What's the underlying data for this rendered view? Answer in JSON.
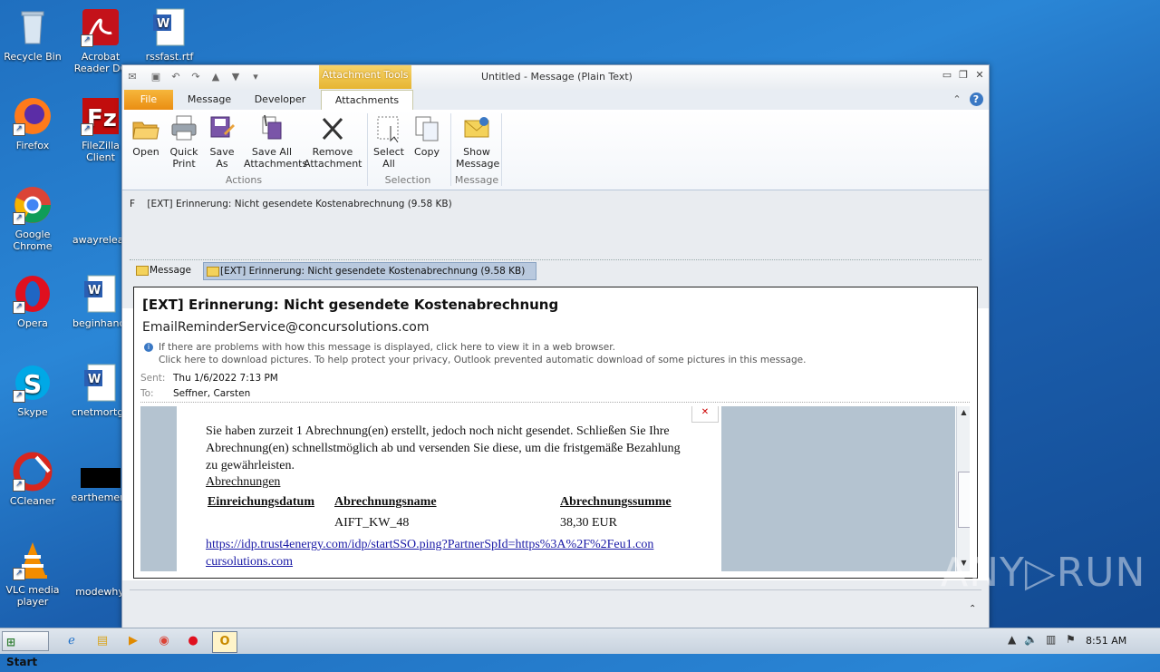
{
  "desktop": {
    "icons": [
      {
        "label": "Recycle Bin",
        "icon": "recycle-bin-icon"
      },
      {
        "label": "Acrobat Reader DC",
        "icon": "acrobat-icon"
      },
      {
        "label": "rssfast.rtf",
        "icon": "word-doc-icon"
      },
      {
        "label": "Firefox",
        "icon": "firefox-icon"
      },
      {
        "label": "FileZilla Client",
        "icon": "filezilla-icon"
      },
      {
        "label": "Google Chrome",
        "icon": "chrome-icon"
      },
      {
        "label": "awayreleas",
        "icon": "blank-file-icon"
      },
      {
        "label": "Opera",
        "icon": "opera-icon"
      },
      {
        "label": "beginhand.",
        "icon": "word-doc-icon"
      },
      {
        "label": "Skype",
        "icon": "skype-icon"
      },
      {
        "label": "cnetmortga",
        "icon": "word-doc-icon"
      },
      {
        "label": "CCleaner",
        "icon": "ccleaner-icon"
      },
      {
        "label": "earthemerg",
        "icon": "black-file-icon"
      },
      {
        "label": "VLC media player",
        "icon": "vlc-icon"
      },
      {
        "label": "modewhy.",
        "icon": "blank-file-icon"
      }
    ]
  },
  "window": {
    "title": "Untitled - Message (Plain Text)",
    "context_tools": "Attachment Tools",
    "tabs": [
      "File",
      "Message",
      "Developer",
      "Attachments"
    ],
    "ribbon": {
      "buttons": [
        {
          "label1": "Open",
          "label2": ""
        },
        {
          "label1": "Quick",
          "label2": "Print"
        },
        {
          "label1": "Save",
          "label2": "As"
        },
        {
          "label1": "Save All",
          "label2": "Attachments"
        },
        {
          "label1": "Remove",
          "label2": "Attachment"
        },
        {
          "label1": "Select",
          "label2": "All"
        },
        {
          "label1": "Copy",
          "label2": ""
        },
        {
          "label1": "Show",
          "label2": "Message"
        }
      ],
      "groups": [
        "Actions",
        "Selection",
        "Message"
      ]
    },
    "attachment_line": "F    [EXT] Erinnerung: Nicht gesendete Kostenabrechnung (9.58 KB)",
    "switch_tabs": [
      "Message",
      "[EXT] Erinnerung: Nicht gesendete Kostenabrechnung (9.58 KB)"
    ]
  },
  "email": {
    "subject": "[EXT] Erinnerung: Nicht gesendete Kostenabrechnung",
    "sender": "EmailReminderService@concursolutions.com",
    "info1": "If there are problems with how this message is displayed, click here to view it in a web browser.",
    "info2": "Click here to download pictures. To help protect your privacy, Outlook prevented automatic download of some pictures in this message.",
    "sent_label": "Sent:",
    "sent_value": "Thu 1/6/2022 7:13 PM",
    "to_label": "To:",
    "to_value": "Seffner, Carsten",
    "body_paragraph": "Sie haben zurzeit 1 Abrechnung(en) erstellt, jedoch noch nicht gesendet. Schließen Sie Ihre Abrechnung(en) schnellstmöglich ab und versenden Sie diese, um die fristgemäße Bezahlung zu gewährleisten.",
    "link_abrechnungen": "Abrechnungen",
    "table_headers": [
      "Einreichungsdatum",
      "Abrechnungsname",
      "Abrechnungssumme"
    ],
    "table_row": [
      "",
      "AIFT_KW_48",
      "38,30 EUR"
    ],
    "long_link": "https://idp.trust4energy.com/idp/startSSO.ping?PartnerSpId=https%3A%2F%2Feu1.concursolutions.com"
  },
  "taskbar": {
    "start_label": "Start",
    "clock": "8:51 AM"
  },
  "watermark": "ANY▷RUN"
}
